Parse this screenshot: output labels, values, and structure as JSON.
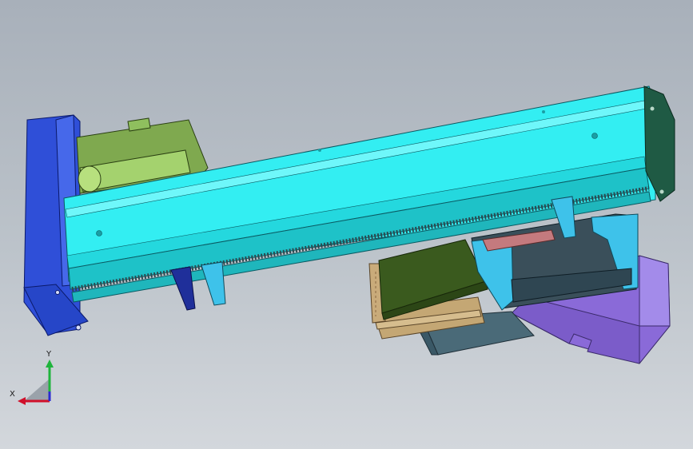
{
  "view": {
    "background_top": "#a8b0ba",
    "background_bottom": "#d3d7dc"
  },
  "triad": {
    "x_label": "X",
    "y_label": "Y",
    "x_color": "#d0102a",
    "y_color": "#1fb43c",
    "z_color": "#2a2ad0"
  },
  "model": {
    "parts": [
      {
        "name": "linear-module-beam",
        "color": "#33eef2"
      },
      {
        "name": "motor",
        "color": "#7fa94f"
      },
      {
        "name": "motor-end-plate",
        "color": "#2f4fd8"
      },
      {
        "name": "idler-end-cap",
        "color": "#1f5a44"
      },
      {
        "name": "carriage-block",
        "color": "#3ec2ea"
      },
      {
        "name": "workpiece-plate",
        "color": "#3a5a1e"
      },
      {
        "name": "base-bracket",
        "color": "#4a6a78"
      },
      {
        "name": "support-block",
        "color": "#8a6ad8"
      },
      {
        "name": "fixture-plate",
        "color": "#c4a774"
      }
    ]
  }
}
